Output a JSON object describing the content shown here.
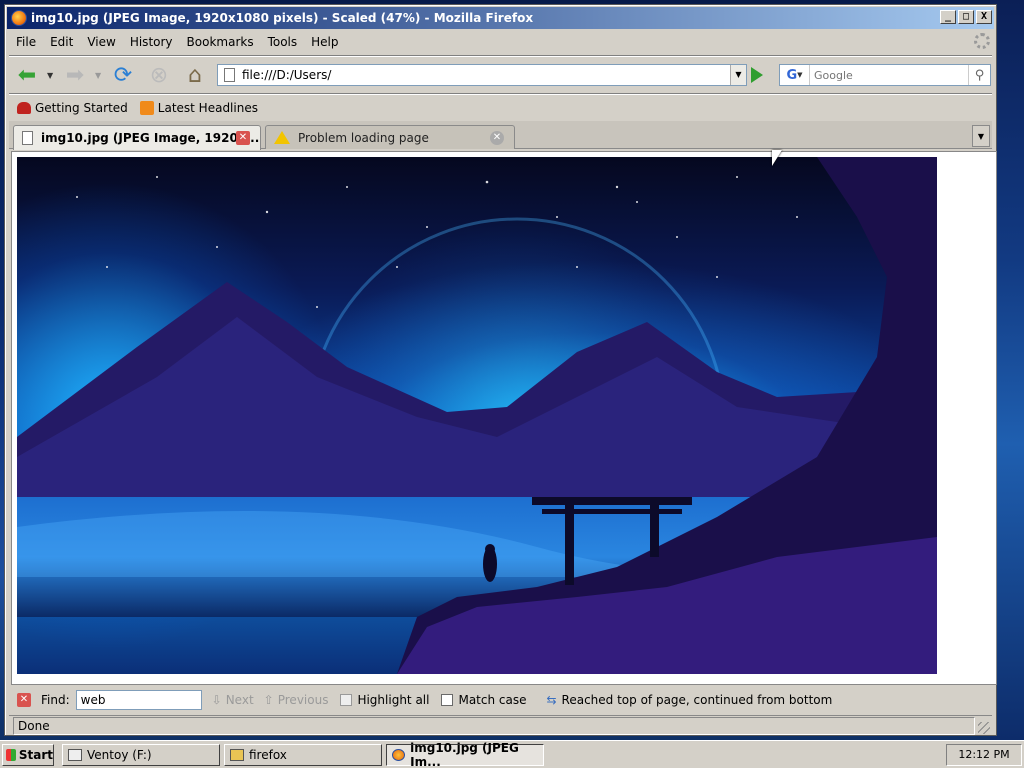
{
  "window": {
    "title": "img10.jpg (JPEG Image, 1920x1080 pixels) - Scaled (47%) - Mozilla Firefox",
    "minimize": "_",
    "maximize": "□",
    "close": "X"
  },
  "menu": {
    "file": "File",
    "edit": "Edit",
    "view": "View",
    "history": "History",
    "bookmarks": "Bookmarks",
    "tools": "Tools",
    "help": "Help"
  },
  "nav": {
    "url": "file:///D:/Users/",
    "search_placeholder": "Google",
    "search_engine": "G"
  },
  "bookmarks": {
    "getting_started": "Getting Started",
    "latest_headlines": "Latest Headlines"
  },
  "tabs": [
    {
      "label": "img10.jpg (JPEG Image, 1920x...",
      "active": true
    },
    {
      "label": "Problem loading page",
      "active": false
    }
  ],
  "findbar": {
    "label": "Find:",
    "value": "web",
    "next": "Next",
    "previous": "Previous",
    "highlight_all": "Highlight all",
    "match_case": "Match case",
    "status": "Reached top of page, continued from bottom"
  },
  "status": {
    "text": "Done"
  },
  "taskbar": {
    "start": "Start",
    "tasks": [
      {
        "label": "Ventoy (F:)"
      },
      {
        "label": "firefox"
      },
      {
        "label": "img10.jpg (JPEG Im..."
      }
    ],
    "clock": "12:12 PM"
  },
  "colors": {
    "titlebar_start": "#0a246a",
    "titlebar_end": "#a6caf0",
    "chrome": "#d4d0c8",
    "close_red": "#d9534f"
  }
}
